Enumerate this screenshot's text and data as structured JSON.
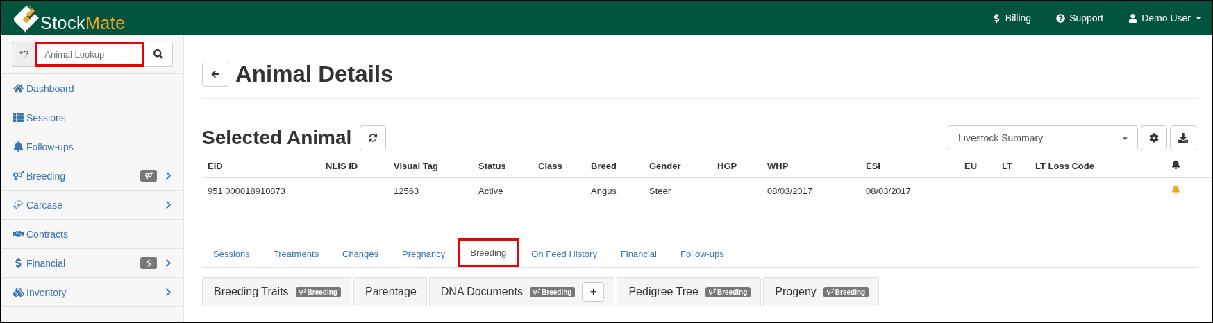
{
  "logo": {
    "name": "Stock",
    "accent": "Mate"
  },
  "top_nav": [
    {
      "label": "Billing",
      "dropdown": false
    },
    {
      "label": "Support",
      "dropdown": false
    },
    {
      "label": "Demo User",
      "dropdown": true
    }
  ],
  "sidebar": {
    "search": {
      "prefix": "*?",
      "placeholder": "Animal Lookup",
      "highlighted": true
    },
    "items": [
      {
        "label": "Dashboard",
        "badge": false,
        "expandable": false
      },
      {
        "label": "Sessions",
        "badge": false,
        "expandable": false
      },
      {
        "label": "Follow-ups",
        "badge": false,
        "expandable": false
      },
      {
        "label": "Breeding",
        "badge": true,
        "expandable": true
      },
      {
        "label": "Carcase",
        "badge": false,
        "expandable": true
      },
      {
        "label": "Contracts",
        "badge": false,
        "expandable": false
      },
      {
        "label": "Financial",
        "badge": true,
        "expandable": true
      },
      {
        "label": "Inventory",
        "badge": false,
        "expandable": true
      }
    ]
  },
  "page_title": "Animal Details",
  "section_title": "Selected Animal",
  "report_select": {
    "value": "Livestock Summary"
  },
  "table": {
    "columns": [
      "EID",
      "NLIS ID",
      "Visual Tag",
      "Status",
      "Class",
      "Breed",
      "Gender",
      "HGP",
      "WHP",
      "ESI",
      "EU",
      "LT",
      "LT Loss Code"
    ],
    "rows": [
      {
        "cells": [
          "951 000018910873",
          "",
          "12563",
          "Active",
          "",
          "Angus",
          "Steer",
          "",
          "08/03/2017",
          "08/03/2017",
          "",
          "",
          ""
        ],
        "alert": true
      }
    ]
  },
  "tabs": [
    {
      "label": "Sessions",
      "selected": false,
      "highlighted": false
    },
    {
      "label": "Treatments",
      "selected": false,
      "highlighted": false
    },
    {
      "label": "Changes",
      "selected": false,
      "highlighted": false
    },
    {
      "label": "Pregnancy",
      "selected": false,
      "highlighted": false
    },
    {
      "label": "Breeding",
      "selected": true,
      "highlighted": true
    },
    {
      "label": "On Feed History",
      "selected": false,
      "highlighted": false
    },
    {
      "label": "Financial",
      "selected": false,
      "highlighted": false
    },
    {
      "label": "Follow-ups",
      "selected": false,
      "highlighted": false
    }
  ],
  "panels": [
    {
      "title": "Breeding Traits",
      "badge": "Breeding"
    },
    {
      "title": "Parentage"
    },
    {
      "title": "DNA Documents",
      "badge": "Breeding",
      "add_button": "+"
    },
    {
      "title": "Pedigree Tree",
      "badge": "Breeding"
    },
    {
      "title": "Progeny",
      "badge": "Breeding"
    }
  ]
}
